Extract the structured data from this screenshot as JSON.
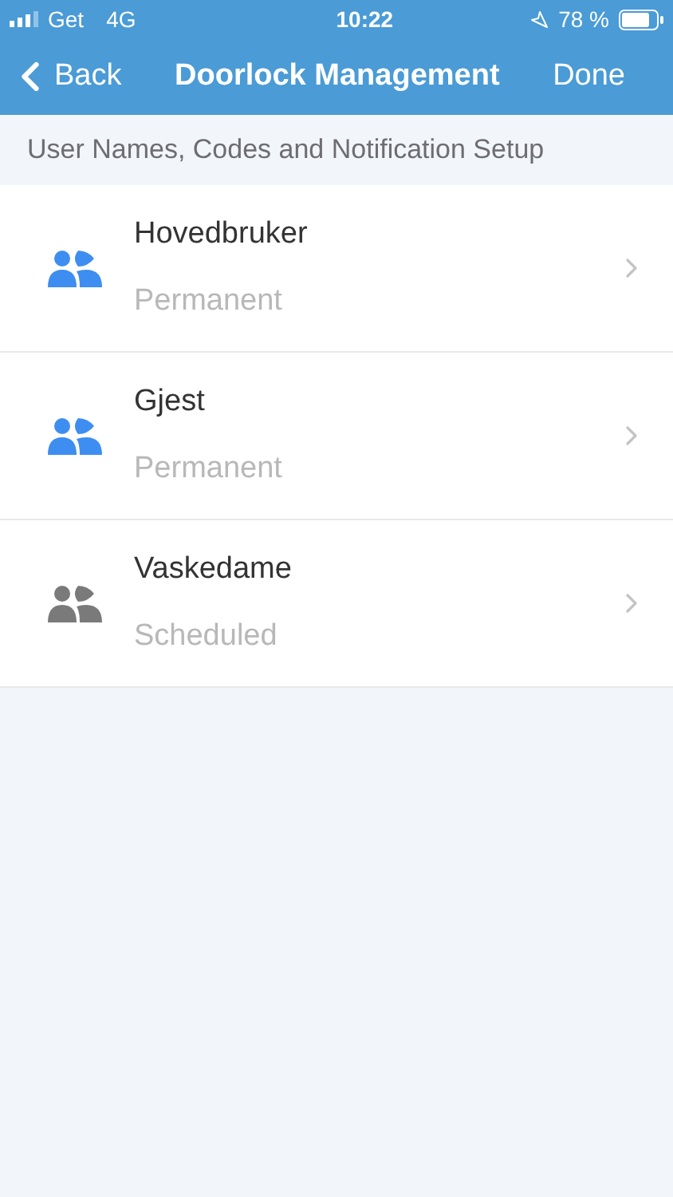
{
  "status_bar": {
    "carrier": "Get",
    "network": "4G",
    "time": "10:22",
    "battery": "78 %"
  },
  "nav": {
    "back": "Back",
    "title": "Doorlock Management",
    "done": "Done"
  },
  "section_header": "User Names, Codes and Notification Setup",
  "users": [
    {
      "name": "Hovedbruker",
      "type": "Permanent",
      "color": "#3d8ef0"
    },
    {
      "name": "Gjest",
      "type": "Permanent",
      "color": "#3d8ef0"
    },
    {
      "name": "Vaskedame",
      "type": "Scheduled",
      "color": "#7a7a7a"
    }
  ]
}
